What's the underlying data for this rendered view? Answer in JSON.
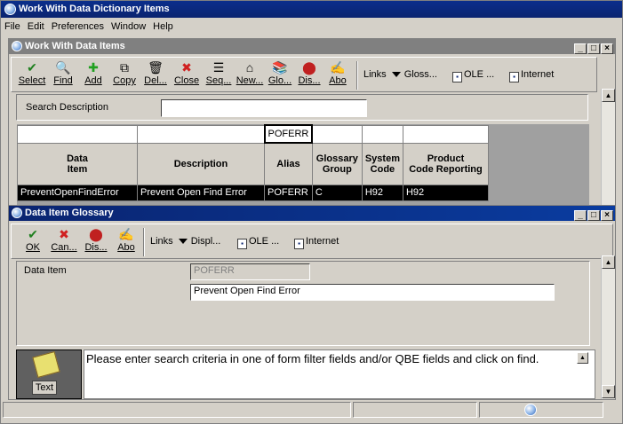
{
  "app": {
    "title": "Work With Data Dictionary Items"
  },
  "menu": [
    "File",
    "Edit",
    "Preferences",
    "Window",
    "Help"
  ],
  "window1": {
    "title": "Work With Data Items",
    "toolbar": [
      {
        "icon": "check-icon",
        "glyph": "✔",
        "color": "#208020",
        "label": "Select"
      },
      {
        "icon": "find-icon",
        "glyph": "🔍",
        "color": "#000000",
        "label": "Find"
      },
      {
        "icon": "add-icon",
        "glyph": "✚",
        "color": "#20a020",
        "label": "Add"
      },
      {
        "icon": "copy-icon",
        "glyph": "⧉",
        "color": "#000000",
        "label": "Copy"
      },
      {
        "icon": "delete-icon",
        "glyph": "🗑",
        "color": "#000000",
        "label": "Del..."
      },
      {
        "icon": "close-icon",
        "glyph": "✖",
        "color": "#d02020",
        "label": "Close"
      },
      {
        "icon": "sequence-icon",
        "glyph": "☰",
        "color": "#000000",
        "label": "Seq..."
      },
      {
        "icon": "new-icon",
        "glyph": "⌂",
        "color": "#000000",
        "label": "New..."
      },
      {
        "icon": "glossary-icon",
        "glyph": "📚",
        "color": "#806020",
        "label": "Glo..."
      },
      {
        "icon": "display-icon",
        "glyph": "⬤",
        "color": "#c02020",
        "label": "Dis..."
      },
      {
        "icon": "abo-icon",
        "glyph": "✍",
        "color": "#000000",
        "label": "Abo"
      }
    ],
    "links_label": "Links",
    "links": [
      "Gloss...",
      "OLE ...",
      "Internet"
    ],
    "search_label": "Search Description",
    "search_value": "",
    "qbe_alias": "POFERR",
    "columns": [
      "Data\nItem",
      "Description",
      "Alias",
      "Glossary\nGroup",
      "System\nCode",
      "Product\nCode Reporting"
    ],
    "row": [
      "PreventOpenFindError",
      "Prevent Open Find Error",
      "POFERR",
      "C",
      "H92",
      "H92"
    ]
  },
  "window2": {
    "title": "Data Item Glossary",
    "toolbar": [
      {
        "icon": "ok-check-icon",
        "glyph": "✔",
        "color": "#208020",
        "label": "OK"
      },
      {
        "icon": "cancel-icon",
        "glyph": "✖",
        "color": "#d02020",
        "label": "Can..."
      },
      {
        "icon": "display-icon",
        "glyph": "⬤",
        "color": "#c02020",
        "label": "Dis..."
      },
      {
        "icon": "abo-icon",
        "glyph": "✍",
        "color": "#000000",
        "label": "Abo"
      }
    ],
    "links_label": "Links",
    "links": [
      "Displ...",
      "OLE ...",
      "Internet"
    ],
    "data_item_label": "Data Item",
    "data_item_value": "POFERR",
    "description_value": "Prevent Open Find Error",
    "text_label": "Text",
    "message": "Please enter search criteria in one of form filter fields and/or QBE fields and click on find."
  }
}
